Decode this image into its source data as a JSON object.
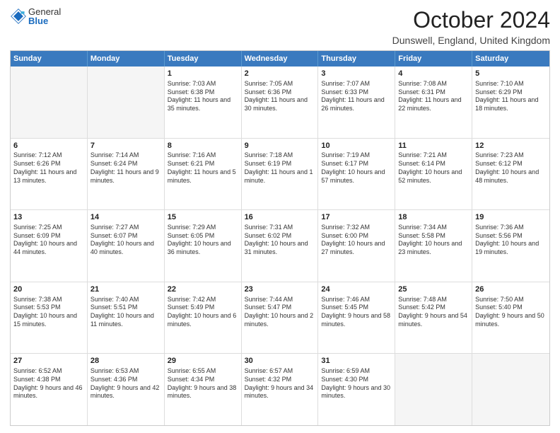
{
  "header": {
    "logo": {
      "general": "General",
      "blue": "Blue"
    },
    "title": "October 2024",
    "location": "Dunswell, England, United Kingdom"
  },
  "calendar": {
    "days": [
      "Sunday",
      "Monday",
      "Tuesday",
      "Wednesday",
      "Thursday",
      "Friday",
      "Saturday"
    ],
    "rows": [
      [
        {
          "day": "",
          "content": ""
        },
        {
          "day": "",
          "content": ""
        },
        {
          "day": "1",
          "content": "Sunrise: 7:03 AM\nSunset: 6:38 PM\nDaylight: 11 hours and 35 minutes."
        },
        {
          "day": "2",
          "content": "Sunrise: 7:05 AM\nSunset: 6:36 PM\nDaylight: 11 hours and 30 minutes."
        },
        {
          "day": "3",
          "content": "Sunrise: 7:07 AM\nSunset: 6:33 PM\nDaylight: 11 hours and 26 minutes."
        },
        {
          "day": "4",
          "content": "Sunrise: 7:08 AM\nSunset: 6:31 PM\nDaylight: 11 hours and 22 minutes."
        },
        {
          "day": "5",
          "content": "Sunrise: 7:10 AM\nSunset: 6:29 PM\nDaylight: 11 hours and 18 minutes."
        }
      ],
      [
        {
          "day": "6",
          "content": "Sunrise: 7:12 AM\nSunset: 6:26 PM\nDaylight: 11 hours and 13 minutes."
        },
        {
          "day": "7",
          "content": "Sunrise: 7:14 AM\nSunset: 6:24 PM\nDaylight: 11 hours and 9 minutes."
        },
        {
          "day": "8",
          "content": "Sunrise: 7:16 AM\nSunset: 6:21 PM\nDaylight: 11 hours and 5 minutes."
        },
        {
          "day": "9",
          "content": "Sunrise: 7:18 AM\nSunset: 6:19 PM\nDaylight: 11 hours and 1 minute."
        },
        {
          "day": "10",
          "content": "Sunrise: 7:19 AM\nSunset: 6:17 PM\nDaylight: 10 hours and 57 minutes."
        },
        {
          "day": "11",
          "content": "Sunrise: 7:21 AM\nSunset: 6:14 PM\nDaylight: 10 hours and 52 minutes."
        },
        {
          "day": "12",
          "content": "Sunrise: 7:23 AM\nSunset: 6:12 PM\nDaylight: 10 hours and 48 minutes."
        }
      ],
      [
        {
          "day": "13",
          "content": "Sunrise: 7:25 AM\nSunset: 6:09 PM\nDaylight: 10 hours and 44 minutes."
        },
        {
          "day": "14",
          "content": "Sunrise: 7:27 AM\nSunset: 6:07 PM\nDaylight: 10 hours and 40 minutes."
        },
        {
          "day": "15",
          "content": "Sunrise: 7:29 AM\nSunset: 6:05 PM\nDaylight: 10 hours and 36 minutes."
        },
        {
          "day": "16",
          "content": "Sunrise: 7:31 AM\nSunset: 6:02 PM\nDaylight: 10 hours and 31 minutes."
        },
        {
          "day": "17",
          "content": "Sunrise: 7:32 AM\nSunset: 6:00 PM\nDaylight: 10 hours and 27 minutes."
        },
        {
          "day": "18",
          "content": "Sunrise: 7:34 AM\nSunset: 5:58 PM\nDaylight: 10 hours and 23 minutes."
        },
        {
          "day": "19",
          "content": "Sunrise: 7:36 AM\nSunset: 5:56 PM\nDaylight: 10 hours and 19 minutes."
        }
      ],
      [
        {
          "day": "20",
          "content": "Sunrise: 7:38 AM\nSunset: 5:53 PM\nDaylight: 10 hours and 15 minutes."
        },
        {
          "day": "21",
          "content": "Sunrise: 7:40 AM\nSunset: 5:51 PM\nDaylight: 10 hours and 11 minutes."
        },
        {
          "day": "22",
          "content": "Sunrise: 7:42 AM\nSunset: 5:49 PM\nDaylight: 10 hours and 6 minutes."
        },
        {
          "day": "23",
          "content": "Sunrise: 7:44 AM\nSunset: 5:47 PM\nDaylight: 10 hours and 2 minutes."
        },
        {
          "day": "24",
          "content": "Sunrise: 7:46 AM\nSunset: 5:45 PM\nDaylight: 9 hours and 58 minutes."
        },
        {
          "day": "25",
          "content": "Sunrise: 7:48 AM\nSunset: 5:42 PM\nDaylight: 9 hours and 54 minutes."
        },
        {
          "day": "26",
          "content": "Sunrise: 7:50 AM\nSunset: 5:40 PM\nDaylight: 9 hours and 50 minutes."
        }
      ],
      [
        {
          "day": "27",
          "content": "Sunrise: 6:52 AM\nSunset: 4:38 PM\nDaylight: 9 hours and 46 minutes."
        },
        {
          "day": "28",
          "content": "Sunrise: 6:53 AM\nSunset: 4:36 PM\nDaylight: 9 hours and 42 minutes."
        },
        {
          "day": "29",
          "content": "Sunrise: 6:55 AM\nSunset: 4:34 PM\nDaylight: 9 hours and 38 minutes."
        },
        {
          "day": "30",
          "content": "Sunrise: 6:57 AM\nSunset: 4:32 PM\nDaylight: 9 hours and 34 minutes."
        },
        {
          "day": "31",
          "content": "Sunrise: 6:59 AM\nSunset: 4:30 PM\nDaylight: 9 hours and 30 minutes."
        },
        {
          "day": "",
          "content": ""
        },
        {
          "day": "",
          "content": ""
        }
      ]
    ]
  }
}
